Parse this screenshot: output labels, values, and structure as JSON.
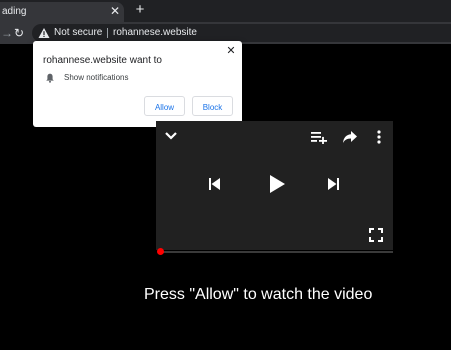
{
  "browser": {
    "tab": {
      "title": "ading",
      "close_glyph": "✕"
    },
    "new_tab_glyph": "+",
    "toolbar": {
      "forward_glyph": "→",
      "reload_glyph": "↻"
    },
    "omnibox": {
      "security_label": "Not secure",
      "url": "rohannese.website"
    }
  },
  "permission_prompt": {
    "title": "rohannese.website want to",
    "permission": "Show notifications",
    "allow_label": "Allow",
    "block_label": "Block",
    "close_glyph": "✕"
  },
  "video_player": {
    "icons": [
      "chevron-down-icon",
      "add-to-queue-icon",
      "share-icon",
      "more-vert-icon",
      "previous-icon",
      "play-icon",
      "next-icon",
      "fullscreen-icon"
    ],
    "progress": 0.0
  },
  "caption": "Press \"Allow\" to watch the video",
  "colors": {
    "background": "#000000",
    "accent": "#1a73e8",
    "progress": "#ff0000"
  }
}
